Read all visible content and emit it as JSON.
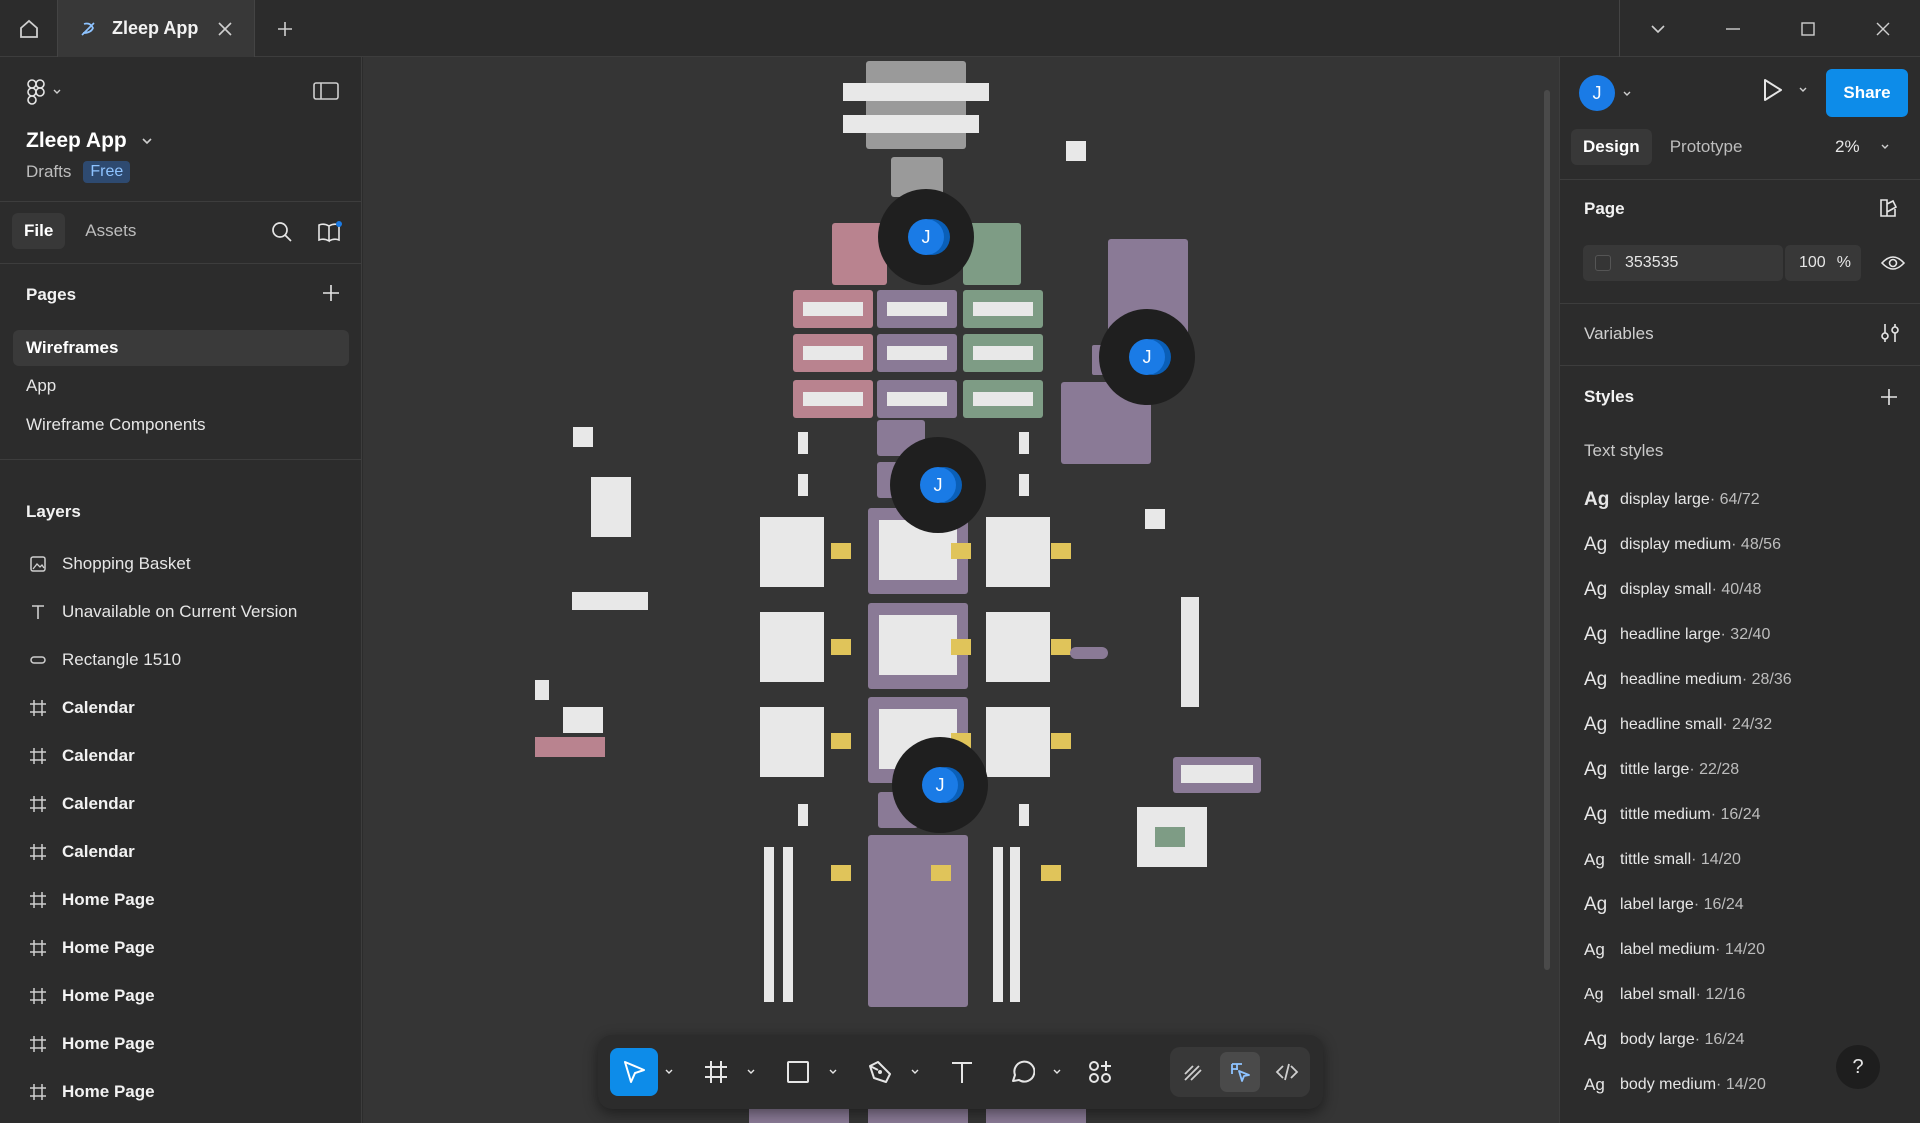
{
  "titlebar": {
    "tab_title": "Zleep App"
  },
  "sidebar": {
    "project_name": "Zleep App",
    "location": "Drafts",
    "plan_badge": "Free",
    "tabs": [
      "File",
      "Assets"
    ],
    "pages_title": "Pages",
    "pages": [
      {
        "label": "Wireframes",
        "active": true
      },
      {
        "label": "App",
        "active": false
      },
      {
        "label": "Wireframe Components",
        "active": false
      }
    ],
    "layers_title": "Layers",
    "layers": [
      {
        "label": "Shopping Basket",
        "icon": "image-icon",
        "frame": false
      },
      {
        "label": "Unavailable on Current Version",
        "icon": "text-icon",
        "frame": false
      },
      {
        "label": "Rectangle 1510",
        "icon": "rectangle-icon",
        "frame": false
      },
      {
        "label": "Calendar",
        "icon": "frame-icon",
        "frame": true
      },
      {
        "label": "Calendar",
        "icon": "frame-icon",
        "frame": true
      },
      {
        "label": "Calendar",
        "icon": "frame-icon",
        "frame": true
      },
      {
        "label": "Calendar",
        "icon": "frame-icon",
        "frame": true
      },
      {
        "label": "Home Page",
        "icon": "frame-icon",
        "frame": true
      },
      {
        "label": "Home Page",
        "icon": "frame-icon",
        "frame": true
      },
      {
        "label": "Home Page",
        "icon": "frame-icon",
        "frame": true
      },
      {
        "label": "Home Page",
        "icon": "frame-icon",
        "frame": true
      },
      {
        "label": "Home Page",
        "icon": "frame-icon",
        "frame": true
      }
    ]
  },
  "canvas": {
    "cursor_initial": "J"
  },
  "right": {
    "avatar_initial": "J",
    "share_label": "Share",
    "tabs": [
      "Design",
      "Prototype"
    ],
    "zoom": "2%",
    "page_title": "Page",
    "page_color": "353535",
    "page_opacity": "100",
    "opacity_unit": "%",
    "variables_title": "Variables",
    "styles_title": "Styles",
    "text_styles_title": "Text styles",
    "text_styles": [
      {
        "name": "display large",
        "meta": " · 64/72"
      },
      {
        "name": "display medium",
        "meta": " · 48/56"
      },
      {
        "name": "display small",
        "meta": " · 40/48"
      },
      {
        "name": "headline large",
        "meta": " · 32/40"
      },
      {
        "name": "headline medium",
        "meta": " · 28/36"
      },
      {
        "name": "headline small",
        "meta": " · 24/32"
      },
      {
        "name": "tittle large",
        "meta": " · 22/28"
      },
      {
        "name": "tittle medium",
        "meta": " · 16/24"
      },
      {
        "name": "tittle small",
        "meta": " · 14/20"
      },
      {
        "name": "label large",
        "meta": " · 16/24"
      },
      {
        "name": "label medium",
        "meta": " · 14/20"
      },
      {
        "name": "label small",
        "meta": " · 12/16"
      },
      {
        "name": "body large",
        "meta": " · 16/24"
      },
      {
        "name": "body medium",
        "meta": " · 14/20"
      }
    ],
    "ag_label": "Ag",
    "help_label": "?"
  },
  "colors": {
    "accent": "#0d8ce9",
    "avatar": "#1a7be6",
    "canvas_bg": "#353535",
    "frame_pink": "#b9838f",
    "frame_green": "#7e9c85",
    "frame_purple": "#8a7a96",
    "frame_gray": "#9a9a9a"
  }
}
